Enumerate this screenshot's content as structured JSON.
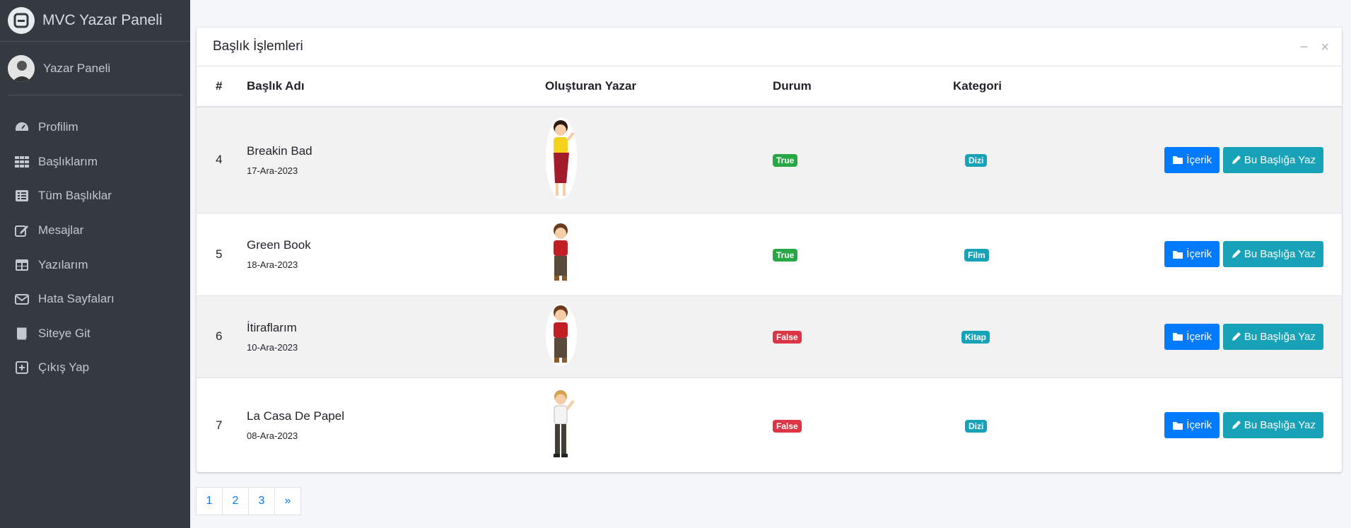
{
  "sidebar": {
    "brand": "MVC Yazar Paneli",
    "user": "Yazar Paneli",
    "items": [
      {
        "label": "Profilim"
      },
      {
        "label": "Başlıklarım"
      },
      {
        "label": "Tüm Başlıklar"
      },
      {
        "label": "Mesajlar"
      },
      {
        "label": "Yazılarım"
      },
      {
        "label": "Hata Sayfaları"
      },
      {
        "label": "Siteye Git"
      },
      {
        "label": "Çıkış Yap"
      }
    ]
  },
  "card": {
    "title": "Başlık İşlemleri",
    "columns": [
      "#",
      "Başlık Adı",
      "Oluşturan Yazar",
      "Durum",
      "Kategori"
    ],
    "rows": [
      {
        "id": "4",
        "title": "Breakin Bad",
        "date": "17-Ara-2023",
        "status": "True",
        "category": "Dizi"
      },
      {
        "id": "5",
        "title": "Green Book",
        "date": "18-Ara-2023",
        "status": "True",
        "category": "Film"
      },
      {
        "id": "6",
        "title": "İtiraflarım",
        "date": "10-Ara-2023",
        "status": "False",
        "category": "Kitap"
      },
      {
        "id": "7",
        "title": "La Casa De Papel",
        "date": "08-Ara-2023",
        "status": "False",
        "category": "Dizi"
      }
    ],
    "buttons": {
      "content": "İçerik",
      "write": "Bu Başlığa Yaz"
    }
  },
  "pagination": [
    "1",
    "2",
    "3",
    "»"
  ],
  "colors": {
    "sidebar": "#343a40",
    "primary": "#007bff",
    "info": "#17a2b8",
    "success": "#28a745",
    "danger": "#dc3545"
  }
}
